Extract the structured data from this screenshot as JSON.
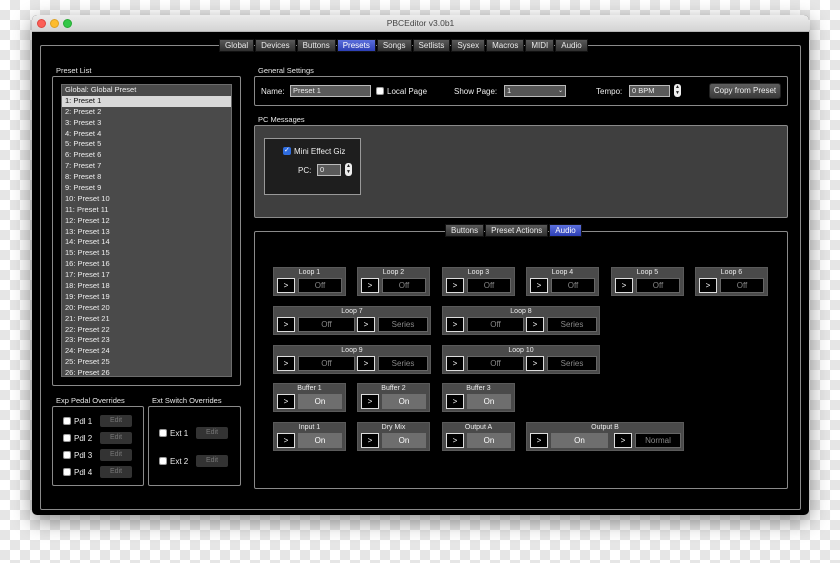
{
  "window": {
    "title": "PBCEditor v3.0b1"
  },
  "main_tabs": [
    {
      "label": "Global"
    },
    {
      "label": "Devices"
    },
    {
      "label": "Buttons"
    },
    {
      "label": "Presets"
    },
    {
      "label": "Songs"
    },
    {
      "label": "Setlists"
    },
    {
      "label": "Sysex"
    },
    {
      "label": "Macros"
    },
    {
      "label": "MIDI"
    },
    {
      "label": "Audio"
    }
  ],
  "preset_list": {
    "label": "Preset List",
    "items": [
      "Global: Global Preset",
      "1: Preset 1",
      "2: Preset 2",
      "3: Preset 3",
      "4: Preset 4",
      "5: Preset 5",
      "6: Preset 6",
      "7: Preset 7",
      "8: Preset 8",
      "9: Preset 9",
      "10: Preset 10",
      "11: Preset 11",
      "12: Preset 12",
      "13: Preset 13",
      "14: Preset 14",
      "15: Preset 15",
      "16: Preset 16",
      "17: Preset 17",
      "18: Preset 18",
      "19: Preset 19",
      "20: Preset 20",
      "21: Preset 21",
      "22: Preset 22",
      "23: Preset 23",
      "24: Preset 24",
      "25: Preset 25",
      "26: Preset 26"
    ],
    "selected": "1: Preset 1"
  },
  "exp_pedal": {
    "label": "Exp Pedal Overrides",
    "items": [
      {
        "label": "Pdl 1"
      },
      {
        "label": "Pdl 2"
      },
      {
        "label": "Pdl 3"
      },
      {
        "label": "Pdl 4"
      }
    ],
    "edit_label": "Edit"
  },
  "ext_switch": {
    "label": "Ext Switch Overrides",
    "items": [
      {
        "label": "Ext 1"
      },
      {
        "label": "Ext 2"
      }
    ],
    "edit_label": "Edit"
  },
  "general": {
    "label": "General Settings",
    "name_label": "Name:",
    "name_value": "Preset 1",
    "local_page_label": "Local Page",
    "show_page_label": "Show Page:",
    "show_page_value": "1",
    "tempo_label": "Tempo:",
    "tempo_value": "0 BPM",
    "copy_label": "Copy from Preset"
  },
  "pc": {
    "label": "PC Messages",
    "device_label": "Mini Effect Giz",
    "pc_label": "PC:",
    "pc_value": "0"
  },
  "sub_tabs": [
    {
      "label": "Buttons"
    },
    {
      "label": "Preset Actions"
    },
    {
      "label": "Audio"
    }
  ],
  "arrow_glyph": ">",
  "modules": {
    "row1": [
      {
        "title": "Loop 1",
        "value": "Off"
      },
      {
        "title": "Loop 2",
        "value": "Off"
      },
      {
        "title": "Loop 3",
        "value": "Off"
      },
      {
        "title": "Loop 4",
        "value": "Off"
      },
      {
        "title": "Loop 5",
        "value": "Off"
      },
      {
        "title": "Loop 6",
        "value": "Off"
      }
    ],
    "row2": [
      {
        "title": "Loop 7",
        "value": "Off",
        "mode": "Series"
      },
      {
        "title": "Loop 8",
        "value": "Off",
        "mode": "Series"
      }
    ],
    "row3": [
      {
        "title": "Loop 9",
        "value": "Off",
        "mode": "Series"
      },
      {
        "title": "Loop 10",
        "value": "Off",
        "mode": "Series"
      }
    ],
    "row4": [
      {
        "title": "Buffer 1",
        "value": "On"
      },
      {
        "title": "Buffer 2",
        "value": "On"
      },
      {
        "title": "Buffer 3",
        "value": "On"
      }
    ],
    "row5": [
      {
        "title": "Input 1",
        "value": "On"
      },
      {
        "title": "Dry Mix",
        "value": "On"
      },
      {
        "title": "Output A",
        "value": "On"
      }
    ],
    "output_b": {
      "title": "Output B",
      "value": "On",
      "mode": "Normal"
    }
  },
  "colors": {
    "accent": "#3446c4",
    "window_bg": "#000000",
    "panel_bg": "#4a4a4a"
  }
}
